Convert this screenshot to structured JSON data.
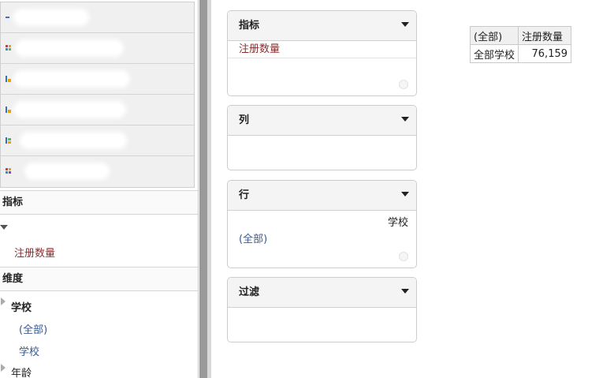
{
  "left_panel": {
    "cubes": [
      {
        "icon": "cube-icon-dash",
        "blurred_width": 100
      },
      {
        "icon": "cube-icon-multicolor",
        "blurred_width": 128
      },
      {
        "icon": "cube-icon-bars",
        "blurred_width": 140
      },
      {
        "icon": "cube-icon-bars",
        "blurred_width": 135
      },
      {
        "icon": "cube-icon-multicolor",
        "blurred_width": 130
      },
      {
        "icon": "cube-icon-grid",
        "blurred_width": 100
      }
    ],
    "measures_header": "指标",
    "measure_item": "注册数量",
    "dimensions_header": "维度",
    "dimension_school": "学校",
    "school_all": "(全部)",
    "school_level": "学校",
    "dimension_age": "年龄"
  },
  "cards": {
    "measures": {
      "title": "指标",
      "item": "注册数量"
    },
    "columns": {
      "title": "列"
    },
    "rows": {
      "title": "行",
      "field": "学校",
      "value": "(全部)"
    },
    "filter": {
      "title": "过滤"
    }
  },
  "result_table": {
    "header_col1": "(全部)",
    "header_col2": "注册数量",
    "row_label": "全部学校",
    "row_value": "76,159"
  },
  "colors": {
    "measure_text": "#8b2e2e",
    "member_text": "#3a5a8c",
    "splitter": "#9a9a9a"
  }
}
